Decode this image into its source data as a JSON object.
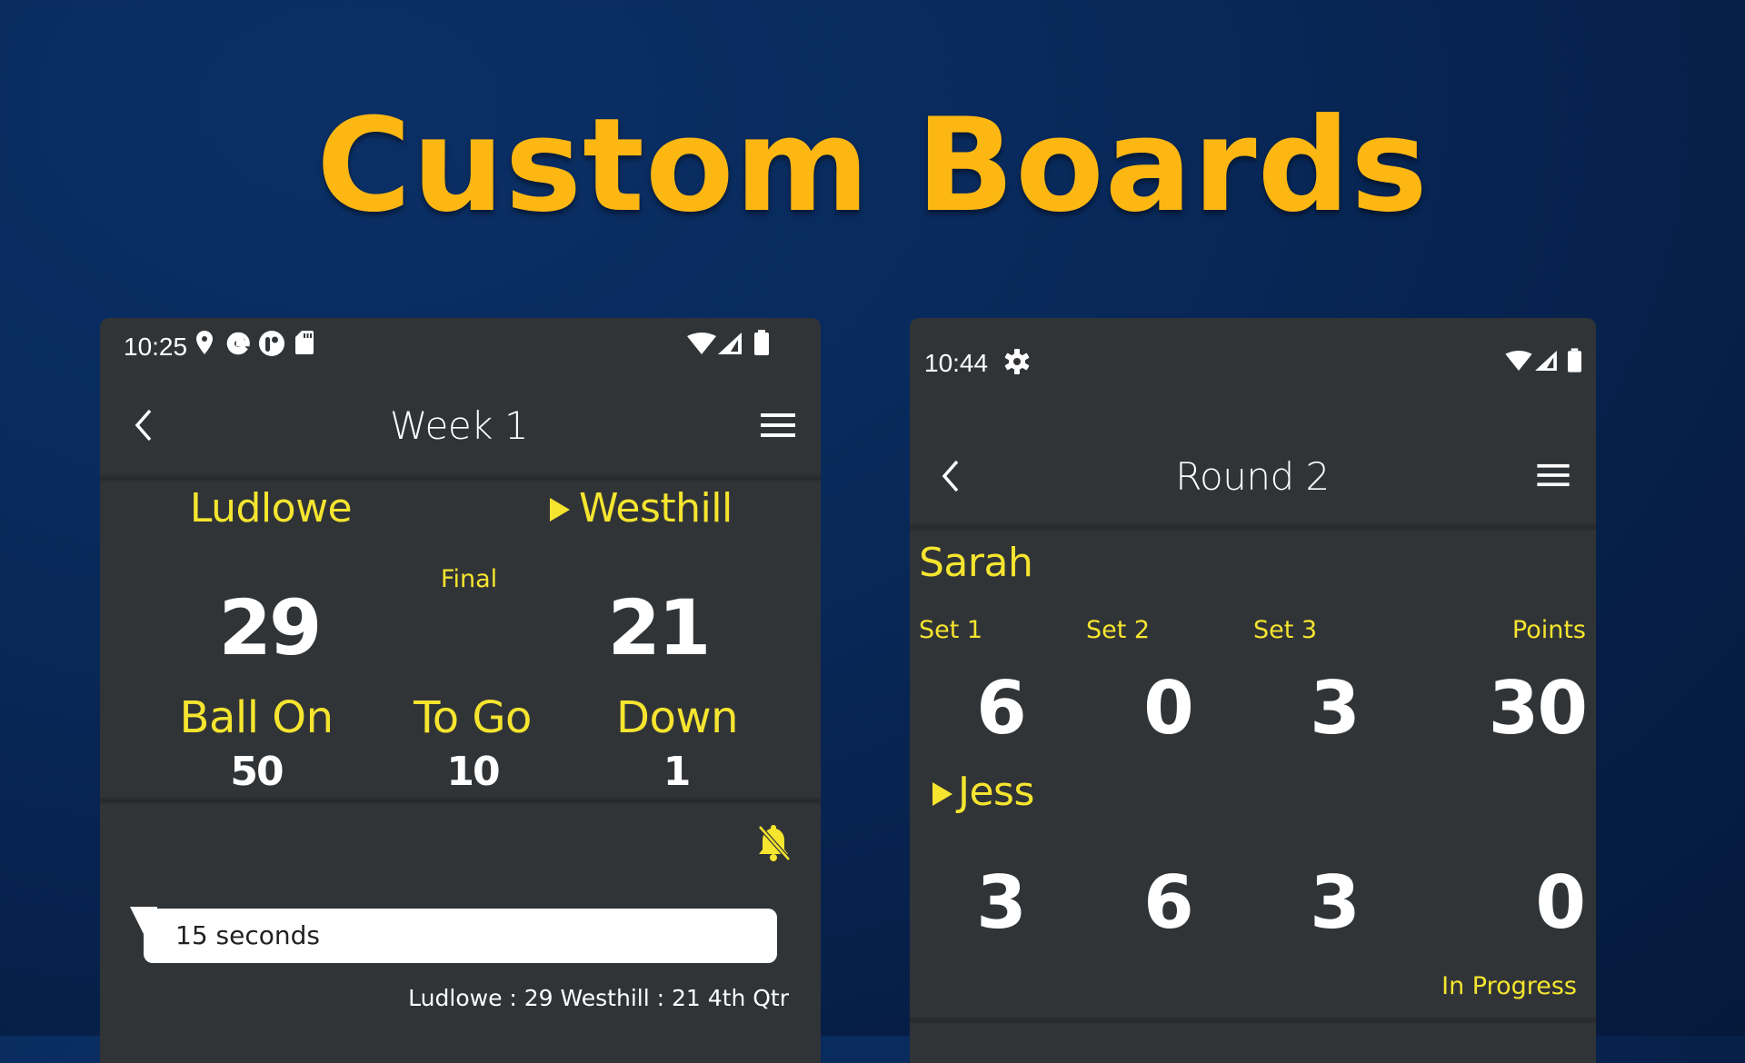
{
  "headline": "Custom Boards",
  "colors": {
    "headline": "#fdb713",
    "accent_yellow": "#f5e52f",
    "panel_bg": "#313437",
    "background": "#08295a"
  },
  "football_board": {
    "status_bar": {
      "time": "10:25",
      "left_icons": [
        "location-pin-icon",
        "google-icon",
        "app-notification-icon",
        "sd-card-icon"
      ],
      "right_icons": [
        "wifi-icon",
        "cell-signal-icon",
        "battery-icon"
      ]
    },
    "toolbar": {
      "back_icon": "chevron-left-icon",
      "title": "Week 1",
      "menu_icon": "hamburger-menu-icon"
    },
    "teams": {
      "home": {
        "name": "Ludlowe",
        "score": "29",
        "possession": false
      },
      "away": {
        "name": "Westhill",
        "score": "21",
        "possession": true
      }
    },
    "period": "Final",
    "stats": [
      {
        "label": "Ball On",
        "value": "50"
      },
      {
        "label": "To Go",
        "value": "10"
      },
      {
        "label": "Down",
        "value": "1"
      }
    ],
    "alert_icon": "bell-off-icon",
    "timer_bubble": "15 seconds",
    "summary": "Ludlowe : 29 Westhill : 21 4th Qtr"
  },
  "tennis_board": {
    "status_bar": {
      "time": "10:44",
      "left_icons": [
        "gear-icon"
      ],
      "right_icons": [
        "wifi-icon",
        "cell-signal-icon",
        "battery-icon"
      ]
    },
    "toolbar": {
      "back_icon": "chevron-left-icon",
      "title": "Round 2",
      "menu_icon": "hamburger-menu-icon"
    },
    "columns": [
      "Set 1",
      "Set 2",
      "Set 3",
      "Points"
    ],
    "players": [
      {
        "name": "Sarah",
        "serving": false,
        "set1": "6",
        "set2": "0",
        "set3": "3",
        "points": "30"
      },
      {
        "name": "Jess",
        "serving": true,
        "set1": "3",
        "set2": "6",
        "set3": "3",
        "points": "0"
      }
    ],
    "status": "In Progress"
  }
}
